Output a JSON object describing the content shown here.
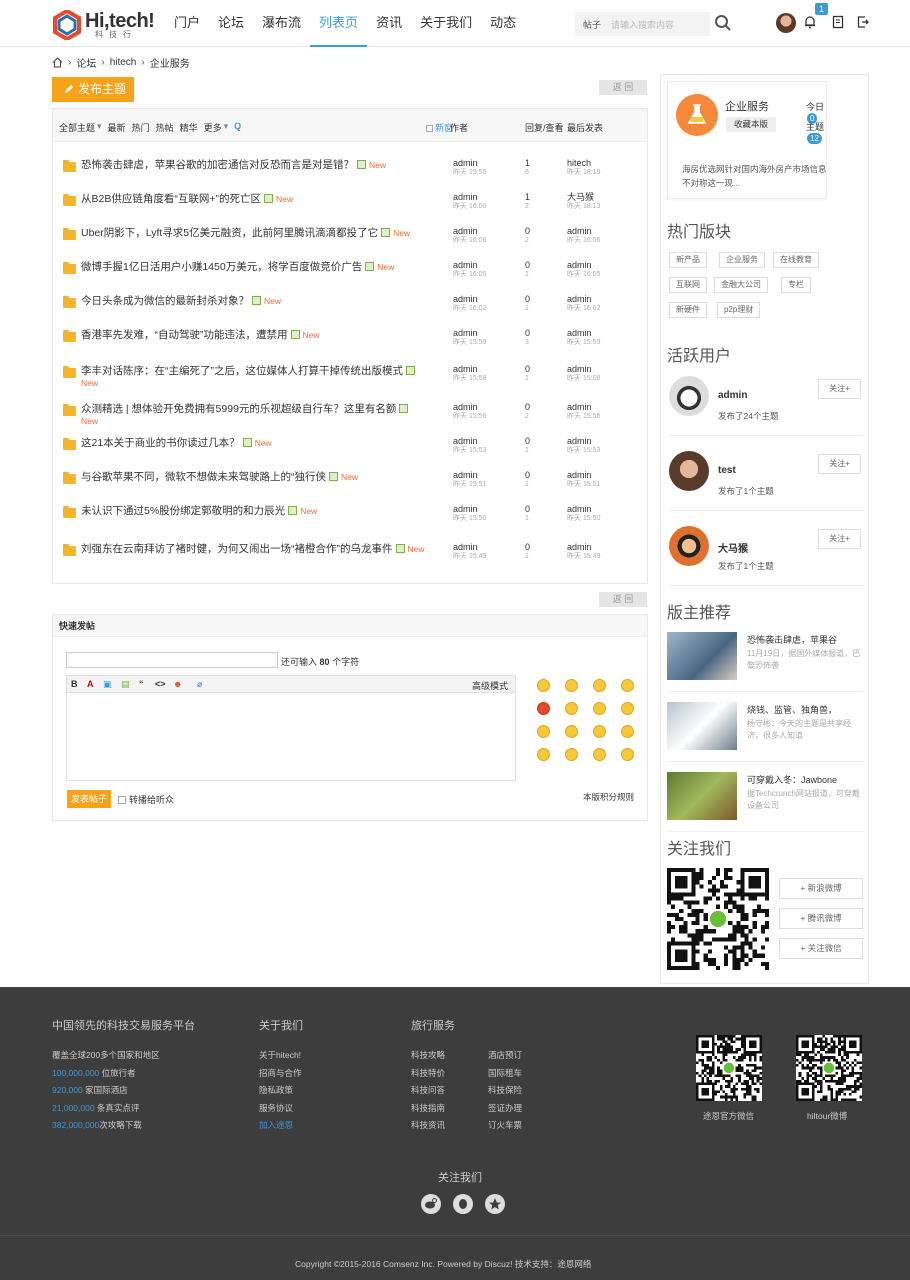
{
  "header": {
    "brand": "Hi,tech!",
    "brand_sub": "科技行",
    "nav": [
      "门户",
      "论坛",
      "瀑布流",
      "列表页",
      "资讯",
      "关于我们",
      "动态"
    ],
    "active_nav": "列表页",
    "search_type": "帖子",
    "search_placeholder": "请输入搜索内容",
    "notify_count": "1"
  },
  "breadcrumb": [
    "论坛",
    "hitech",
    "企业服务"
  ],
  "post_button": "发布主题",
  "back_label": "返 回",
  "thread_list": {
    "filters": [
      "全部主题",
      "最新",
      "热门",
      "热帖",
      "精华",
      "更多"
    ],
    "new_window": "新窗",
    "author_header": "作者",
    "reply_header": "回复/查看",
    "last_header": "最后发表",
    "new_tag": "New",
    "rows": [
      {
        "title": "恐怖袭击肆虐，苹果谷歌的加密通信对反恐而言是对是错？",
        "author": "admin",
        "time": "昨天 15:55",
        "replies": "1",
        "views": "6",
        "last": "hitech",
        "last_time": "昨天 18:19"
      },
      {
        "title": "从B2B供应链角度看“互联网+”的死亡区",
        "author": "admin",
        "time": "昨天 16:00",
        "replies": "1",
        "views": "2",
        "last": "大马猴",
        "last_time": "昨天 18:13"
      },
      {
        "title": "Uber阴影下，Lyft寻求5亿美元融资，此前阿里腾讯滴滴都投了它",
        "author": "admin",
        "time": "昨天 16:06",
        "replies": "0",
        "views": "2",
        "last": "admin",
        "last_time": "昨天 16:06"
      },
      {
        "title": "微博手握1亿日活用户小赚1450万美元，将学百度做竞价广告",
        "author": "admin",
        "time": "昨天 16:05",
        "replies": "0",
        "views": "1",
        "last": "admin",
        "last_time": "昨天 16:05"
      },
      {
        "title": "今日头条成为微信的最新封杀对象？",
        "author": "admin",
        "time": "昨天 16:02",
        "replies": "0",
        "views": "1",
        "last": "admin",
        "last_time": "昨天 16:02"
      },
      {
        "title": "香港率先发难，“自动驾驶”功能违法，遭禁用",
        "author": "admin",
        "time": "昨天 15:59",
        "replies": "0",
        "views": "3",
        "last": "admin",
        "last_time": "昨天 15:59"
      },
      {
        "title": "李丰对话陈序：在“主编死了”之后，这位媒体人打算干掉传统出版模式",
        "author": "admin",
        "time": "昨天 15:58",
        "replies": "0",
        "views": "1",
        "last": "admin",
        "last_time": "昨天 15:58"
      },
      {
        "title": "众测精选 | 想体验开免费拥有5999元的乐视超级自行车？这里有名额",
        "author": "admin",
        "time": "昨天 15:56",
        "replies": "0",
        "views": "2",
        "last": "admin",
        "last_time": "昨天 15:56"
      },
      {
        "title": "这21本关于商业的书你读过几本？",
        "author": "admin",
        "time": "昨天 15:53",
        "replies": "0",
        "views": "1",
        "last": "admin",
        "last_time": "昨天 15:53"
      },
      {
        "title": "与谷歌苹果不同，微软不想做未来驾驶路上的“独行侠",
        "author": "admin",
        "time": "昨天 15:51",
        "replies": "0",
        "views": "1",
        "last": "admin",
        "last_time": "昨天 15:51"
      },
      {
        "title": "未认识下通过5%股份绑定郭敬明的和力辰光",
        "author": "admin",
        "time": "昨天 15:50",
        "replies": "0",
        "views": "1",
        "last": "admin",
        "last_time": "昨天 15:50"
      },
      {
        "title": "刘强东在云南拜访了褚时健，为何又闹出一场“褚橙合作”的乌龙事件",
        "author": "admin",
        "time": "昨天 15:49",
        "replies": "0",
        "views": "1",
        "last": "admin",
        "last_time": "昨天 15:49"
      }
    ]
  },
  "quick_post": {
    "title": "快速发帖",
    "count_prefix": "还可输入",
    "count_num": "80",
    "count_suffix": "个字符",
    "advanced": "高级模式",
    "submit": "发表帖子",
    "forward": "转播给听众",
    "rule": "本版积分规则"
  },
  "forum_info": {
    "name": "企业服务",
    "fav": "收藏本版",
    "today_label": "今日",
    "today": "0",
    "topics_label": "主题",
    "topics": "12",
    "desc": "海房优选网针对国内海外房产市场信息不对称这一现..."
  },
  "hot_sections": {
    "title": "热门版块",
    "tags": [
      "新产品",
      "企业服务",
      "在线教育",
      "互联网",
      "金融大公司",
      "专栏",
      "新硬件",
      "p2p理财"
    ]
  },
  "active_users": {
    "title": "活跃用户",
    "follow": "关注+",
    "users": [
      {
        "name": "admin",
        "desc": "发布了24个主题"
      },
      {
        "name": "test",
        "desc": "发布了1个主题"
      },
      {
        "name": "大马猴",
        "desc": "发布了1个主题"
      }
    ]
  },
  "recommend": {
    "title": "版主推荐",
    "items": [
      {
        "title": "恐怖袭击肆虐，苹果谷",
        "desc": "11月19日，据国外媒体报道，巴黎恐怖袭"
      },
      {
        "title": "烧钱、监管、独角兽，",
        "desc": "杨守彬：今天的主题是共享经济，很多人知道"
      },
      {
        "title": "可穿戴入冬：Jawbone",
        "desc": "据Techcrunch网站报道，可穿戴设备公司"
      }
    ]
  },
  "follow_us": {
    "title": "关注我们",
    "buttons": [
      "+ 新浪微博",
      "+ 腾讯微博",
      "+ 关注微信"
    ]
  },
  "footer": {
    "col1_title": "中国领先的科技交易服务平台",
    "col1_lines": [
      {
        "pre": "",
        "text": "覆盖全球200多个国家和地区"
      },
      {
        "pre": "100,000,000",
        "text": " 位旅行者"
      },
      {
        "pre": "920,000",
        "text": " 家国际酒店"
      },
      {
        "pre": "21,000,000",
        "text": " 条真实点评"
      },
      {
        "pre": "382,000,000",
        "text": "次攻略下载"
      }
    ],
    "col2_title": "关于我们",
    "col2_lines": [
      "关于hitech!",
      "招商与合作",
      "隐私政策",
      "服务协议",
      "加入途恩"
    ],
    "col3_title": "旅行服务",
    "col3_a": [
      "科技攻略",
      "科技特价",
      "科技问答",
      "科技指南",
      "科技资讯"
    ],
    "col3_b": [
      "酒店预订",
      "国际租车",
      "科技保险",
      "签证办理",
      "订火车票"
    ],
    "qr1_label": "途恩官方微信",
    "qr2_label": "hiltour微博",
    "follow_title": "关注我们",
    "copyright": "Copyright  ©2015-2016  Comsenz Inc.  Powered by  Discuz!  技术支持：途恩网络"
  },
  "colors": {
    "accent": "#3b9bd9",
    "orange": "#f6a21a",
    "footer": "#3d3d3d",
    "new": "#f06a3a"
  }
}
